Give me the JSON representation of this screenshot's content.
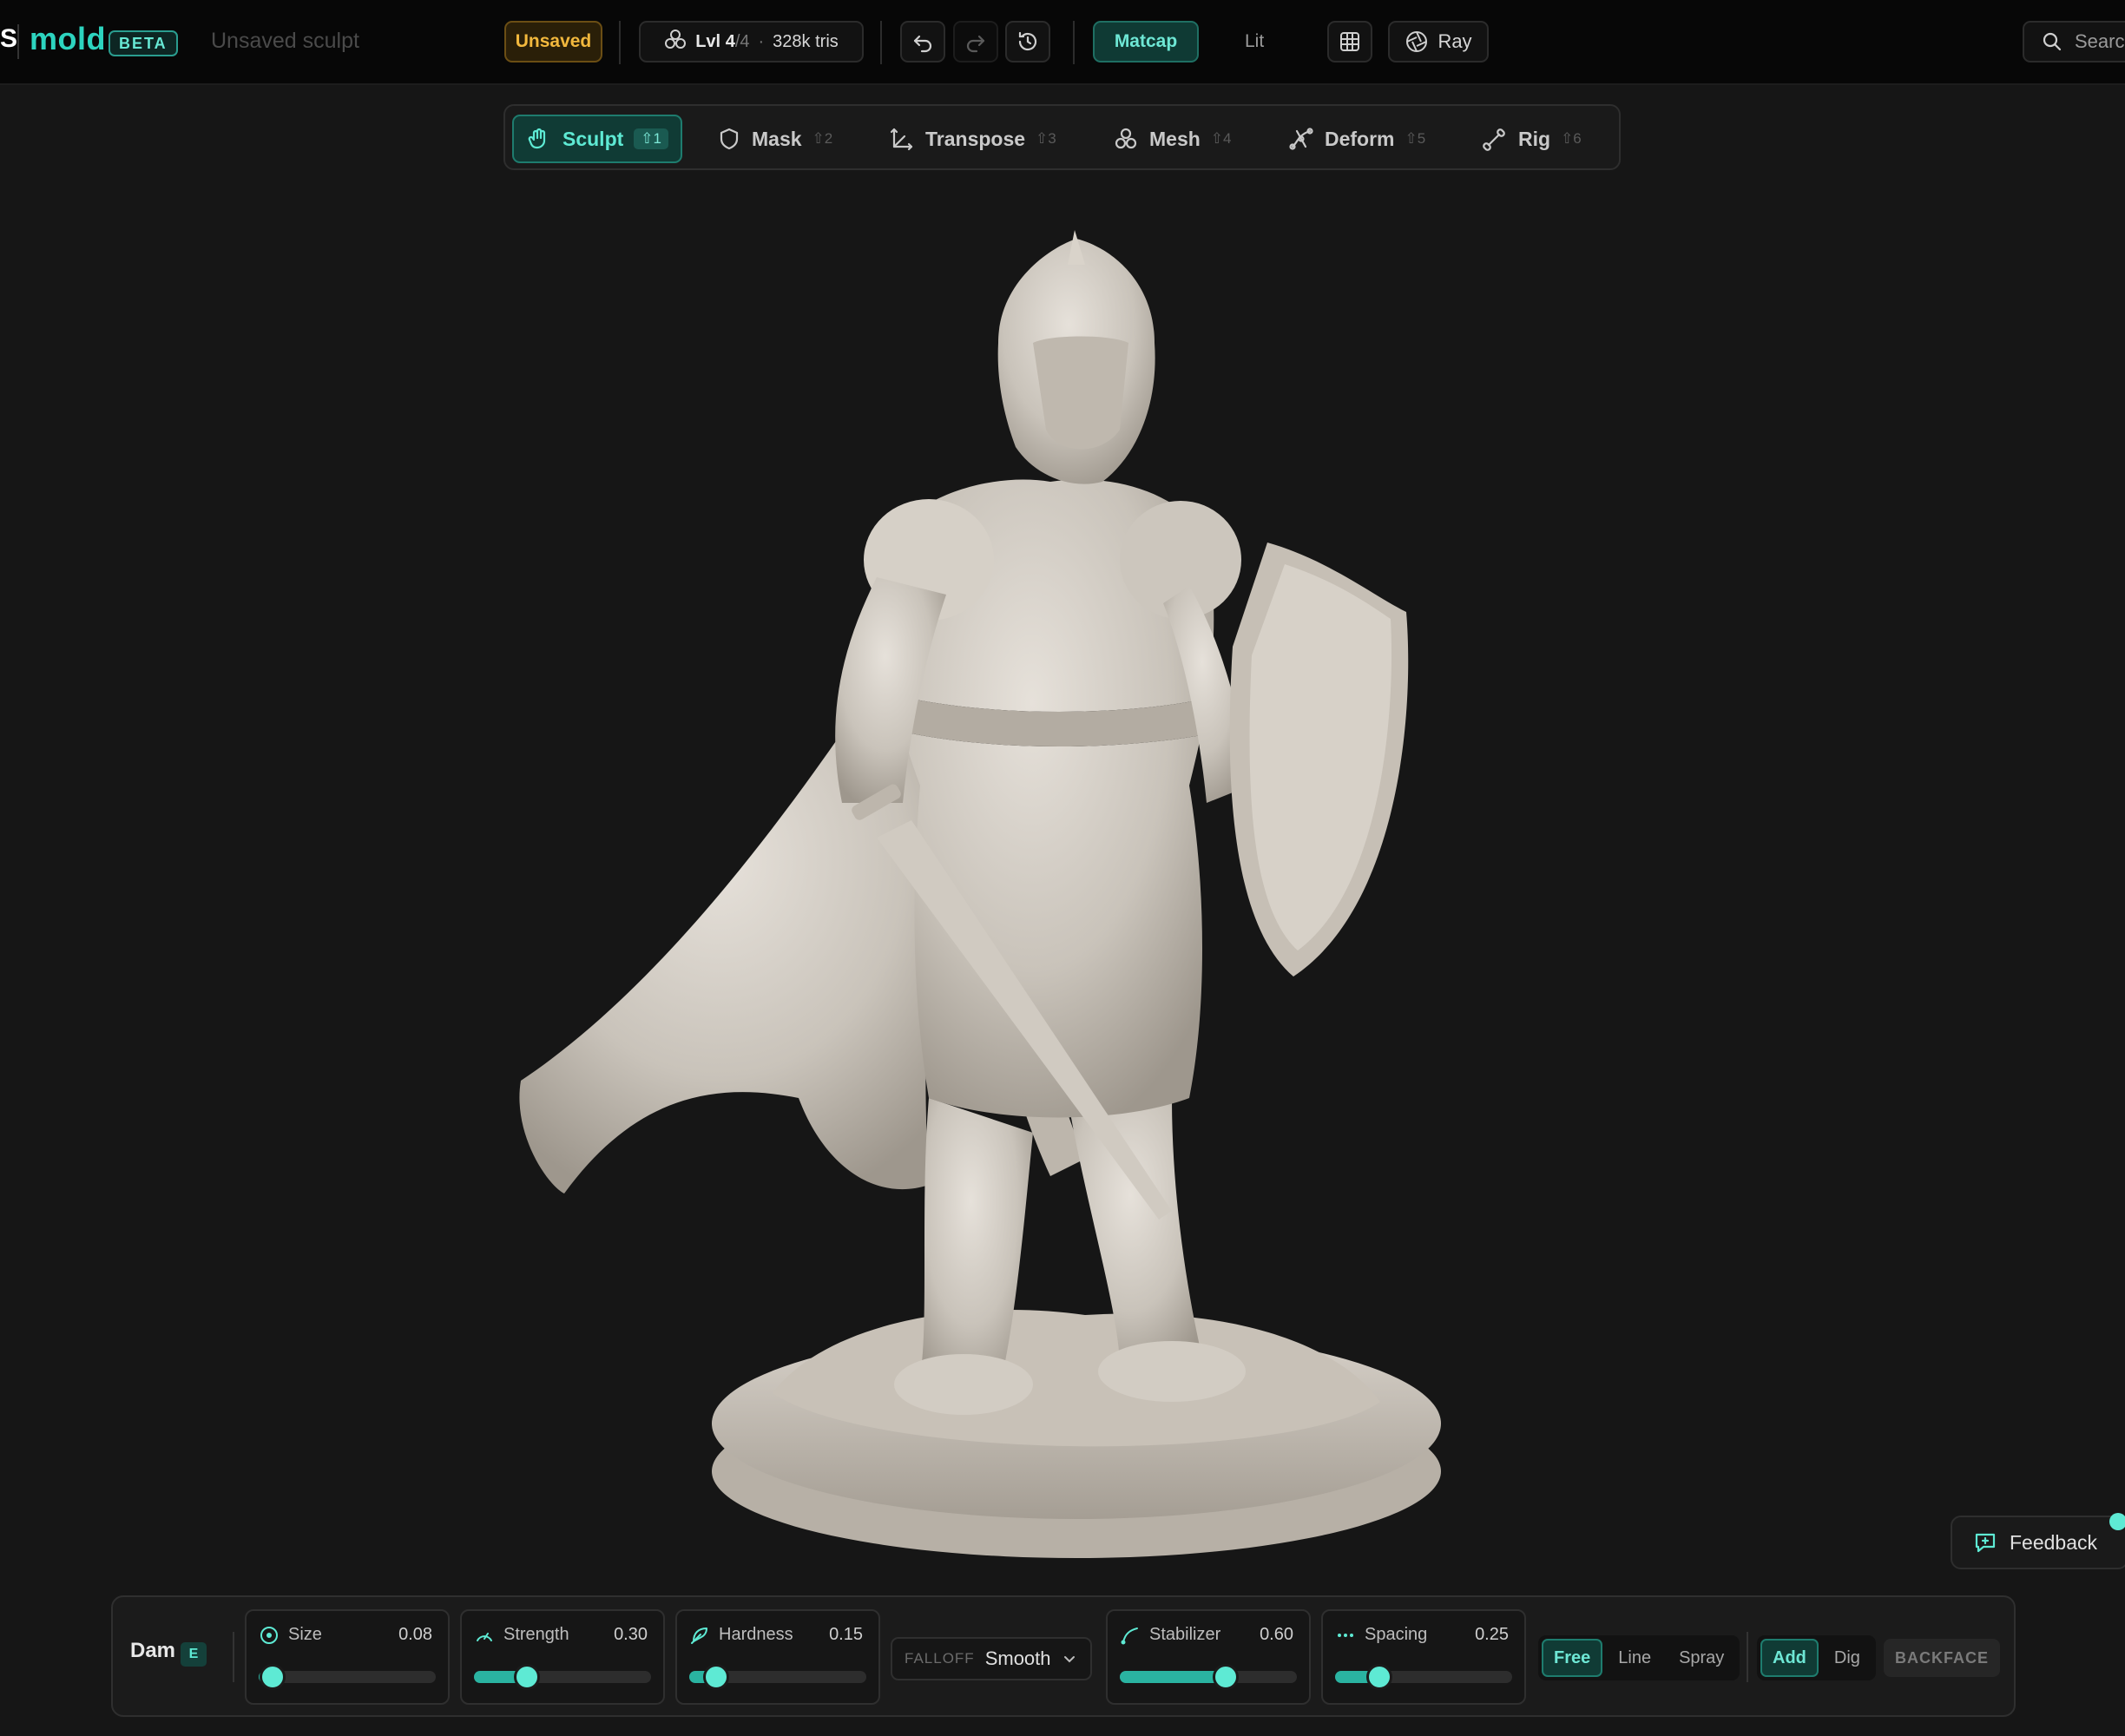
{
  "app": {
    "logo_fragment": "S",
    "name": "mold",
    "badge": "BETA",
    "document_title": "Unsaved sculpt"
  },
  "status": {
    "save_state": "Unsaved"
  },
  "mesh": {
    "level_label": "Lvl",
    "level_current": "4",
    "level_total": "/4",
    "tris": "328k tris"
  },
  "view": {
    "matcap_label": "Matcap",
    "lit_label": "Lit",
    "ray_label": "Ray"
  },
  "search": {
    "label": "Search"
  },
  "modes": [
    {
      "label": "Sculpt",
      "key": "⇧1",
      "icon": "hand-icon",
      "active": true
    },
    {
      "label": "Mask",
      "key": "⇧2",
      "icon": "shield-icon",
      "active": false
    },
    {
      "label": "Transpose",
      "key": "⇧3",
      "icon": "transpose-icon",
      "active": false
    },
    {
      "label": "Mesh",
      "key": "⇧4",
      "icon": "mesh-icon",
      "active": false
    },
    {
      "label": "Deform",
      "key": "⇧5",
      "icon": "deform-icon",
      "active": false
    },
    {
      "label": "Rig",
      "key": "⇧6",
      "icon": "bone-icon",
      "active": false
    }
  ],
  "brush": {
    "name": "Dam",
    "key": "E",
    "params": [
      {
        "label": "Size",
        "value": "0.08",
        "level": 0.08
      },
      {
        "label": "Strength",
        "value": "0.30",
        "level": 0.3
      },
      {
        "label": "Hardness",
        "value": "0.15",
        "level": 0.15
      },
      {
        "label": "Stabilizer",
        "value": "0.60",
        "level": 0.6
      },
      {
        "label": "Spacing",
        "value": "0.25",
        "level": 0.25
      }
    ],
    "falloff_caption": "FALLOFF",
    "falloff_value": "Smooth",
    "stroke_modes": [
      "Free",
      "Line",
      "Spray"
    ],
    "stroke_selected": "Free",
    "direction_modes": [
      "Add",
      "Dig"
    ],
    "direction_selected": "Add",
    "backface_label": "BACKFACE"
  },
  "feedback": {
    "label": "Feedback"
  },
  "colors": {
    "accent": "#5eead4",
    "background": "#161616",
    "warning": "#f2b83d"
  }
}
